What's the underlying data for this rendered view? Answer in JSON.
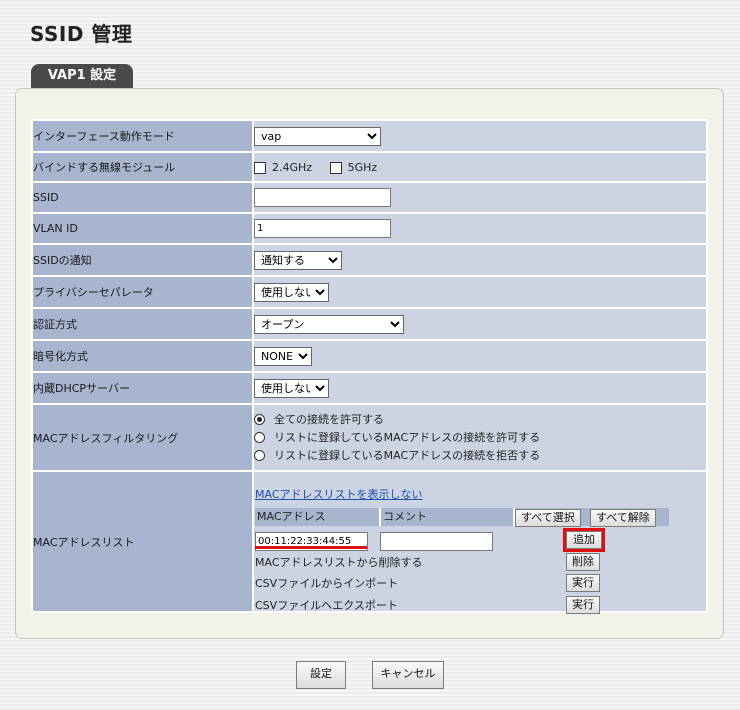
{
  "page": {
    "title": "SSID 管理",
    "tab": "VAP1 設定"
  },
  "rows": {
    "iface_mode": {
      "label": "インターフェース動作モード",
      "value": "vap"
    },
    "bind_module": {
      "label": "バインドする無線モジュール",
      "opt1": "2.4GHz",
      "opt2": "5GHz"
    },
    "ssid": {
      "label": "SSID",
      "value": ""
    },
    "vlan": {
      "label": "VLAN ID",
      "value": "1"
    },
    "ssid_notify": {
      "label": "SSIDの通知",
      "value": "通知する"
    },
    "privacy_sep": {
      "label": "プライバシーセパレータ",
      "value": "使用しない"
    },
    "auth": {
      "label": "認証方式",
      "value": "オープン"
    },
    "encrypt": {
      "label": "暗号化方式",
      "value": "NONE"
    },
    "dhcp": {
      "label": "内蔵DHCPサーバー",
      "value": "使用しない"
    },
    "mac_filter": {
      "label": "MACアドレスフィルタリング",
      "options": [
        "全ての接続を許可する",
        "リストに登録しているMACアドレスの接続を許可する",
        "リストに登録しているMACアドレスの接続を拒否する"
      ]
    },
    "mac_list": {
      "label": "MACアドレスリスト",
      "toggle_link": "MACアドレスリストを表示しない",
      "col_mac": "MACアドレス",
      "col_comment": "コメント",
      "select_all": "すべて選択",
      "clear_all": "すべて解除",
      "mac_value": "00:11:22:33:44:55",
      "comment_value": "",
      "add": "追加",
      "delete_label": "MACアドレスリストから削除する",
      "delete_btn": "削除",
      "import_label": "CSVファイルからインポート",
      "import_btn": "実行",
      "export_label": "CSVファイルへエクスポート",
      "export_btn": "実行"
    }
  },
  "footer": {
    "save": "設定",
    "cancel": "キャンセル"
  },
  "colors": {
    "label_bg": "#a7b5cf",
    "value_bg": "#ccd4e3",
    "highlight": "#e01010",
    "tab_bg": "#4a4a4a"
  }
}
